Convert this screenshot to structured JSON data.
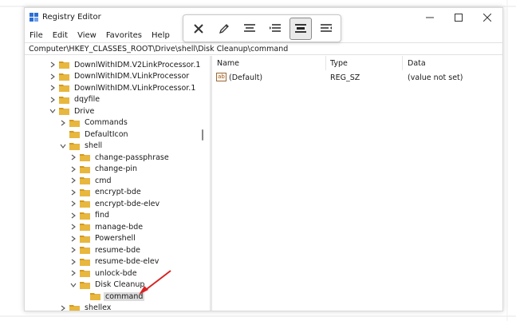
{
  "window": {
    "title": "Registry Editor",
    "min_icon": "minimize-icon",
    "max_icon": "maximize-icon",
    "close_icon": "close-icon"
  },
  "menu": [
    "File",
    "Edit",
    "View",
    "Favorites",
    "Help"
  ],
  "address": "Computer\\HKEY_CLASSES_ROOT\\Drive\\shell\\Disk Cleanup\\command",
  "tree": [
    {
      "label": "DownlWithIDM.V2LinkProcessor.1",
      "depth": 0,
      "state": "collapsed"
    },
    {
      "label": "DownlWithIDM.VLinkProcessor",
      "depth": 0,
      "state": "collapsed"
    },
    {
      "label": "DownlWithIDM.VLinkProcessor.1",
      "depth": 0,
      "state": "collapsed"
    },
    {
      "label": "dqyfile",
      "depth": 0,
      "state": "collapsed"
    },
    {
      "label": "Drive",
      "depth": 0,
      "state": "expanded"
    },
    {
      "label": "Commands",
      "depth": 1,
      "state": "collapsed"
    },
    {
      "label": "DefaultIcon",
      "depth": 1,
      "state": "none"
    },
    {
      "label": "shell",
      "depth": 1,
      "state": "expanded"
    },
    {
      "label": "change-passphrase",
      "depth": 2,
      "state": "collapsed"
    },
    {
      "label": "change-pin",
      "depth": 2,
      "state": "collapsed"
    },
    {
      "label": "cmd",
      "depth": 2,
      "state": "collapsed"
    },
    {
      "label": "encrypt-bde",
      "depth": 2,
      "state": "collapsed"
    },
    {
      "label": "encrypt-bde-elev",
      "depth": 2,
      "state": "collapsed"
    },
    {
      "label": "find",
      "depth": 2,
      "state": "collapsed"
    },
    {
      "label": "manage-bde",
      "depth": 2,
      "state": "collapsed"
    },
    {
      "label": "Powershell",
      "depth": 2,
      "state": "collapsed"
    },
    {
      "label": "resume-bde",
      "depth": 2,
      "state": "collapsed"
    },
    {
      "label": "resume-bde-elev",
      "depth": 2,
      "state": "collapsed"
    },
    {
      "label": "unlock-bde",
      "depth": 2,
      "state": "collapsed"
    },
    {
      "label": "Disk Cleanup",
      "depth": 2,
      "state": "expanded"
    },
    {
      "label": "command",
      "depth": 3,
      "state": "none",
      "selected": true
    },
    {
      "label": "shellex",
      "depth": 1,
      "state": "collapsed"
    }
  ],
  "list": {
    "columns": [
      "Name",
      "Type",
      "Data"
    ],
    "rows": [
      {
        "name": "(Default)",
        "type": "REG_SZ",
        "data": "(value not set)",
        "icon": "ab"
      }
    ]
  },
  "toolbar": {
    "tools": [
      "close-icon",
      "pencil-icon",
      "align-top-icon",
      "align-middle-icon",
      "align-center-icon",
      "align-bottom-icon"
    ],
    "active": "align-center-icon"
  },
  "colors": {
    "folder": "#e8b73d",
    "folder_dark": "#d49a1c",
    "arrow": "#d62424",
    "selection": "#dcdcdc"
  }
}
